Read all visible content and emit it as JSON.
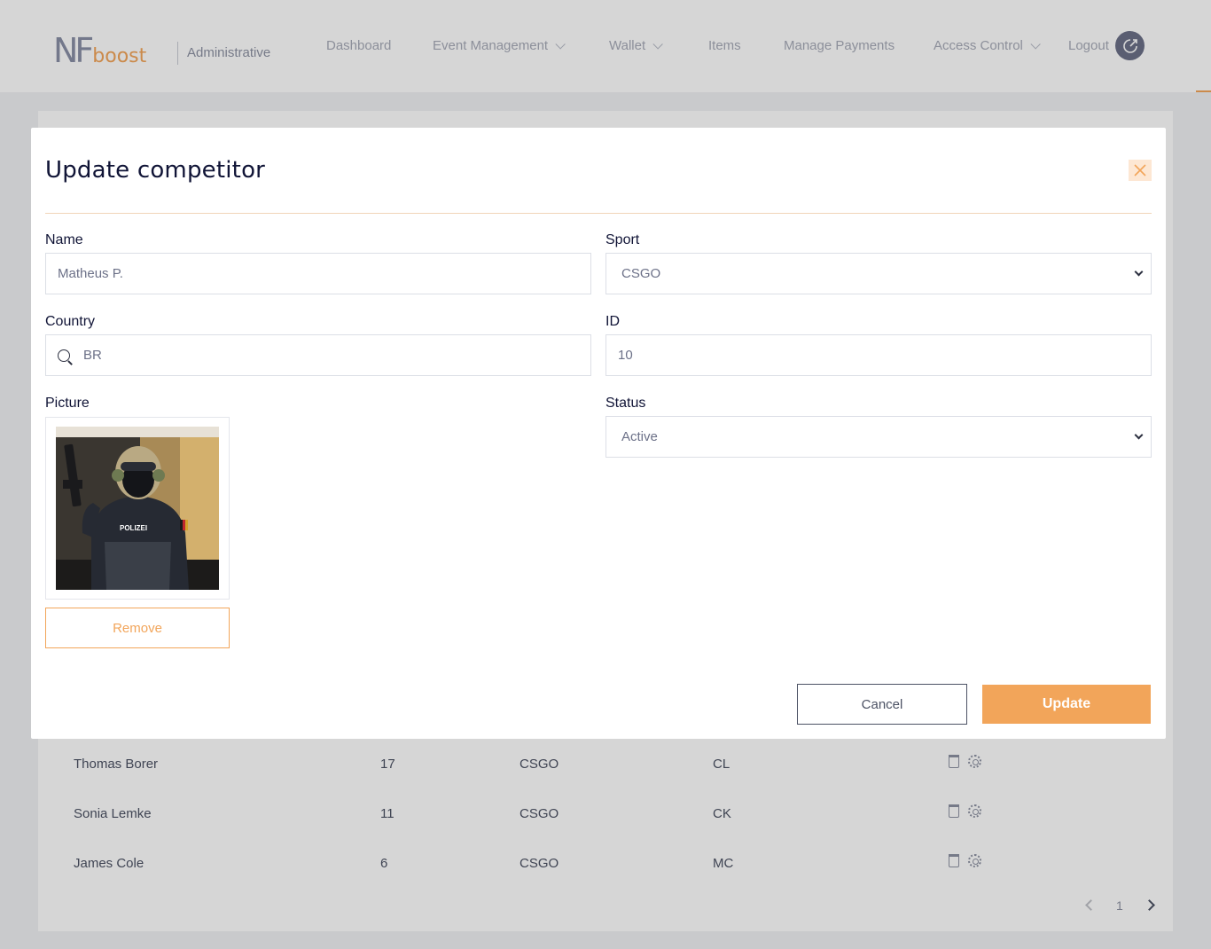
{
  "nav": {
    "logo_nf": "NF",
    "logo_boost": "boost",
    "section": "Administrative",
    "items": [
      {
        "label": "Dashboard",
        "has_dropdown": false
      },
      {
        "label": "Event Management",
        "has_dropdown": true
      },
      {
        "label": "Wallet",
        "has_dropdown": true
      },
      {
        "label": "Items",
        "has_dropdown": false
      },
      {
        "label": "Manage Payments",
        "has_dropdown": false
      },
      {
        "label": "Access Control",
        "has_dropdown": true
      }
    ],
    "logout_label": "Logout"
  },
  "background_table": {
    "rows": [
      {
        "name": "Thomas Borer",
        "id": "17",
        "sport": "CSGO",
        "country": "CL"
      },
      {
        "name": "Sonia Lemke",
        "id": "11",
        "sport": "CSGO",
        "country": "CK"
      },
      {
        "name": "James Cole",
        "id": "6",
        "sport": "CSGO",
        "country": "MC"
      }
    ],
    "pagination": {
      "current_page": "1"
    }
  },
  "modal": {
    "title": "Update competitor",
    "name_label": "Name",
    "name_value": "Matheus P.",
    "sport_label": "Sport",
    "sport_value": "CSGO",
    "country_label": "Country",
    "country_value": "BR",
    "id_label": "ID",
    "id_value": "10",
    "picture_label": "Picture",
    "picture_caption": "POLIZEI",
    "status_label": "Status",
    "status_value": "Active",
    "remove_label": "Remove",
    "cancel_label": "Cancel",
    "update_label": "Update"
  },
  "colors": {
    "accent": "#f2a55a",
    "title": "#101436",
    "border": "#dcdfe6"
  }
}
